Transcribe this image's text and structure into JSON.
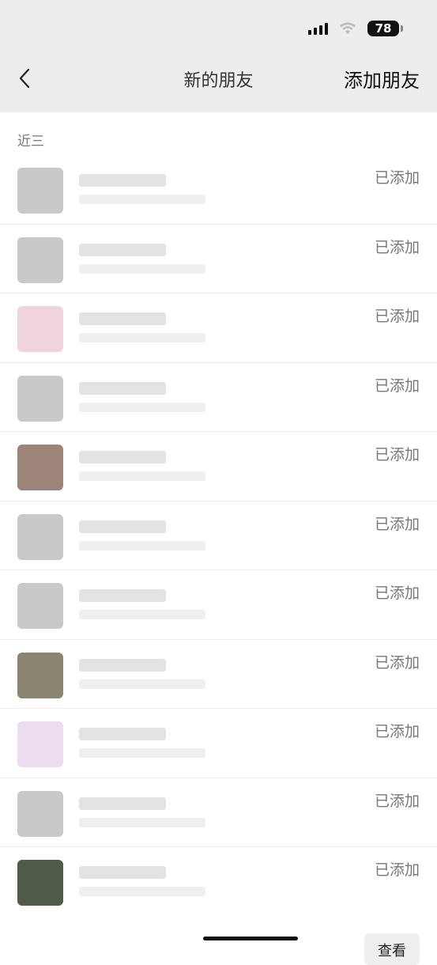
{
  "status_bar": {
    "battery": "78",
    "icons": [
      "signal-icon",
      "wifi-icon",
      "battery-icon"
    ]
  },
  "nav": {
    "back_icon": "chevron-left-icon",
    "title": "新的朋友",
    "action_label": "添加朋友"
  },
  "section": {
    "label": "近三"
  },
  "friends": [
    {
      "status": "已添加"
    },
    {
      "status": "已添加"
    },
    {
      "status": "已添加"
    },
    {
      "status": "已添加"
    },
    {
      "status": "已添加"
    },
    {
      "status": "已添加"
    },
    {
      "status": "已添加"
    },
    {
      "status": "已添加"
    },
    {
      "status": "已添加"
    },
    {
      "status": "已添加"
    },
    {
      "status": "已添加"
    }
  ],
  "footer": {
    "view_label": "查看"
  },
  "colors": {
    "nav_background": "#ededed",
    "status_text": "#777777"
  }
}
